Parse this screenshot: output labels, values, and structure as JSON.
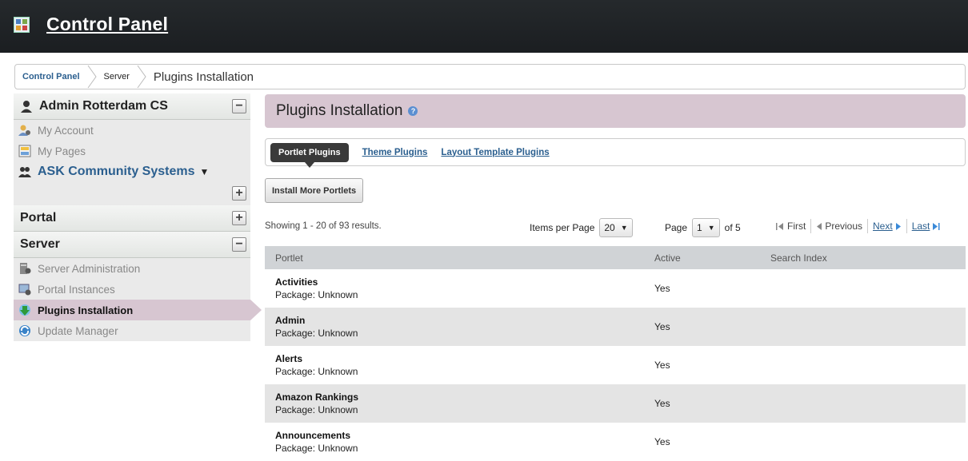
{
  "app": {
    "title": "Control Panel"
  },
  "breadcrumb": {
    "items": [
      "Control Panel",
      "Server",
      "Plugins Installation"
    ]
  },
  "sidebar": {
    "user_section": {
      "title": "Admin Rotterdam CS",
      "toggle": "−"
    },
    "user_items": [
      {
        "label": "My Account",
        "icon": "account-icon"
      },
      {
        "label": "My Pages",
        "icon": "pages-icon"
      }
    ],
    "site_title": "ASK Community Systems",
    "site_caret": "▼",
    "site_add": "+",
    "portal_section": {
      "title": "Portal",
      "toggle": "+"
    },
    "server_section": {
      "title": "Server",
      "toggle": "−"
    },
    "server_items": [
      {
        "label": "Server Administration",
        "icon": "server-admin-icon"
      },
      {
        "label": "Portal Instances",
        "icon": "portal-instances-icon"
      },
      {
        "label": "Plugins Installation",
        "icon": "plugins-install-icon",
        "active": true
      },
      {
        "label": "Update Manager",
        "icon": "update-manager-icon"
      }
    ]
  },
  "main": {
    "title": "Plugins Installation",
    "help": "?",
    "tabs": [
      {
        "label": "Portlet Plugins",
        "active": true
      },
      {
        "label": "Theme Plugins"
      },
      {
        "label": "Layout Template Plugins"
      }
    ],
    "install_button": "Install More Portlets",
    "showing": "Showing 1 - 20 of 93 results.",
    "items_per_page_label": "Items per Page",
    "items_per_page_value": "20",
    "page_label": "Page",
    "page_value": "1",
    "page_of": "of 5",
    "pager": {
      "first": "First",
      "previous": "Previous",
      "next": "Next",
      "last": "Last"
    },
    "table": {
      "headers": [
        "Portlet",
        "Active",
        "Search Index"
      ],
      "rows": [
        {
          "name": "Activities",
          "package": "Package: Unknown",
          "active": "Yes"
        },
        {
          "name": "Admin",
          "package": "Package: Unknown",
          "active": "Yes"
        },
        {
          "name": "Alerts",
          "package": "Package: Unknown",
          "active": "Yes"
        },
        {
          "name": "Amazon Rankings",
          "package": "Package: Unknown",
          "active": "Yes"
        },
        {
          "name": "Announcements",
          "package": "Package: Unknown",
          "active": "Yes"
        }
      ]
    }
  },
  "colors": {
    "accent": "#d7c6d1",
    "link": "#2b5f8f",
    "topbar": "#1f2326"
  }
}
